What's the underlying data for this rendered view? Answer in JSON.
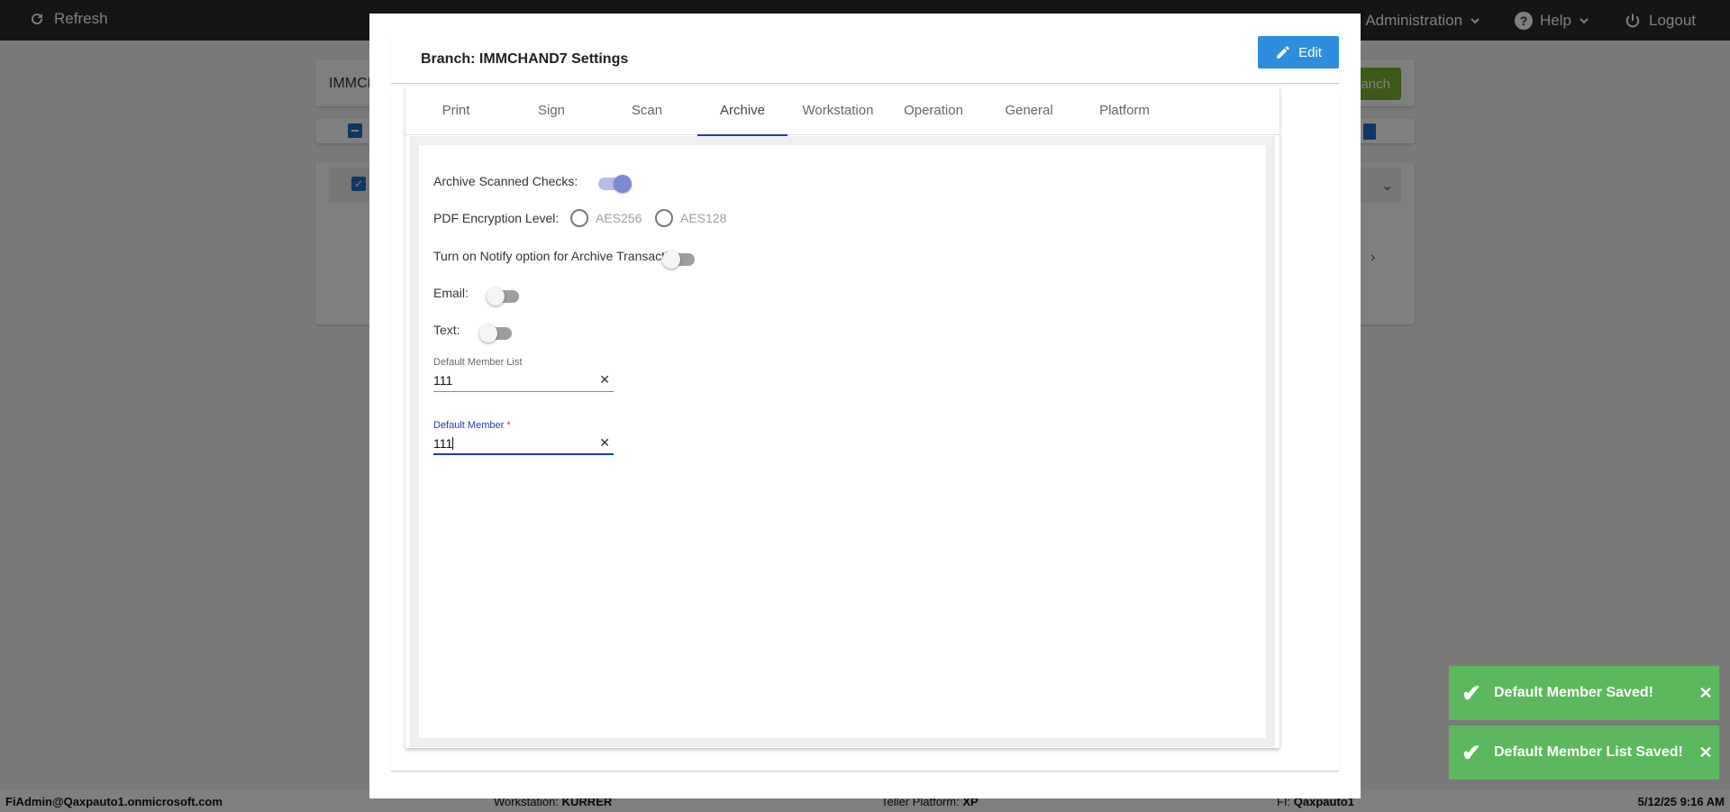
{
  "topbar": {
    "refresh_label": "Refresh",
    "administration_label": "Administration",
    "help_label": "Help",
    "logout_label": "Logout"
  },
  "background": {
    "search_text": "IMMCH",
    "branch_button_label": "anch"
  },
  "footer": {
    "user": "FiAdmin@Qaxpauto1.onmicrosoft.com",
    "workstation_label": "Workstation:",
    "workstation_value": "KURRER",
    "teller_platform_label": "Teller Platform:",
    "teller_platform_value": "XP",
    "fi_label": "FI:",
    "fi_value": "Qaxpauto1",
    "datetime": "5/12/25 9:16 AM"
  },
  "modal": {
    "title": "Branch: IMMCHAND7 Settings",
    "edit_label": "Edit",
    "tabs": [
      {
        "label": "Print"
      },
      {
        "label": "Sign"
      },
      {
        "label": "Scan"
      },
      {
        "label": "Archive",
        "active": true
      },
      {
        "label": "Workstation"
      },
      {
        "label": "Operation"
      },
      {
        "label": "General"
      },
      {
        "label": "Platform"
      }
    ],
    "archive": {
      "archive_scanned_checks_label": "Archive Scanned Checks:",
      "archive_scanned_checks_on": true,
      "pdf_encryption_label": "PDF Encryption Level:",
      "pdf_options": [
        "AES256",
        "AES128"
      ],
      "notify_label": "Turn on Notify option for Archive Transaction:",
      "notify_on": false,
      "email_label": "Email:",
      "email_on": false,
      "text_label": "Text:",
      "text_on": false,
      "default_member_list_label": "Default Member List",
      "default_member_list_value": "111",
      "default_member_label": "Default Member",
      "default_member_required": "*",
      "default_member_value": "111"
    }
  },
  "toasts": [
    {
      "message": "Default Member Saved!"
    },
    {
      "message": "Default Member List Saved!"
    }
  ],
  "colors": {
    "toast_success": "#5cb85c",
    "edit_button": "#2d8ee0",
    "active_tab_underline": "#1a3fa8",
    "topbar": "#2a2a2a"
  }
}
